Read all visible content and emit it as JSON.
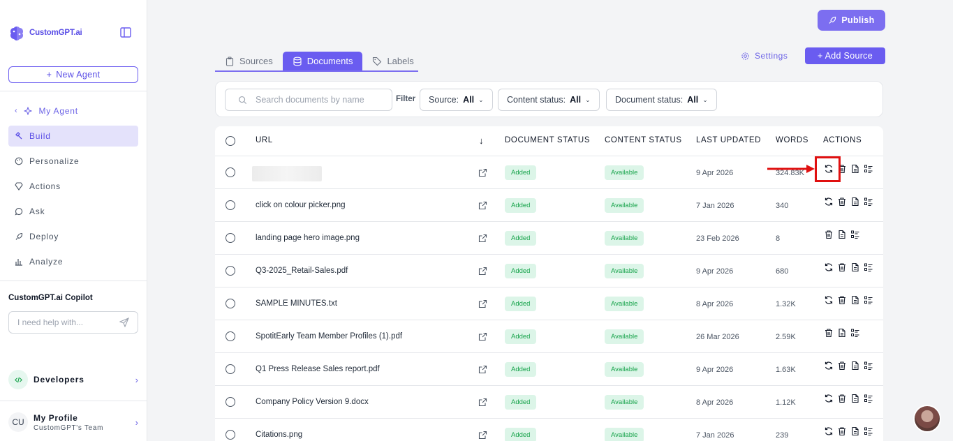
{
  "brand": {
    "name": "CustomGPT.ai"
  },
  "sidebar": {
    "new_agent_label": "New Agent",
    "back_label": "My Agent",
    "items": [
      {
        "label": "Build",
        "icon": "hammer-icon",
        "active": true
      },
      {
        "label": "Personalize",
        "icon": "palette-icon",
        "active": false
      },
      {
        "label": "Actions",
        "icon": "gem-icon",
        "active": false
      },
      {
        "label": "Ask",
        "icon": "chat-icon",
        "active": false
      },
      {
        "label": "Deploy",
        "icon": "rocket-icon",
        "active": false
      },
      {
        "label": "Analyze",
        "icon": "bar-chart-icon",
        "active": false
      }
    ],
    "copilot_title": "CustomGPT.ai Copilot",
    "copilot_placeholder": "I need help with...",
    "developers_label": "Developers",
    "profile": {
      "initials": "CU",
      "name": "My Profile",
      "team": "CustomGPT's Team"
    }
  },
  "header": {
    "publish_label": "Publish",
    "settings_label": "Settings",
    "add_source_label": "Add Source",
    "tabs": [
      {
        "label": "Sources",
        "active": false
      },
      {
        "label": "Documents",
        "active": true
      },
      {
        "label": "Labels",
        "active": false
      }
    ]
  },
  "filters": {
    "search_placeholder": "Search documents by name",
    "filter_label": "Filter",
    "source": {
      "prefix": "Source:",
      "value": "All"
    },
    "content_status": {
      "prefix": "Content status:",
      "value": "All"
    },
    "document_status": {
      "prefix": "Document status:",
      "value": "All"
    }
  },
  "table": {
    "columns": {
      "url": "URL",
      "document_status": "DOCUMENT STATUS",
      "content_status": "CONTENT STATUS",
      "last_updated": "LAST UPDATED",
      "words": "WORDS",
      "actions": "ACTIONS"
    },
    "rows": [
      {
        "name": "",
        "doc_status": "Added",
        "content_status": "Available",
        "date": "9 Apr 2026",
        "words": "324.83K",
        "refresh": true
      },
      {
        "name": "click on colour picker.png",
        "doc_status": "Added",
        "content_status": "Available",
        "date": "7 Jan 2026",
        "words": "340",
        "refresh": true
      },
      {
        "name": "landing page hero image.png",
        "doc_status": "Added",
        "content_status": "Available",
        "date": "23 Feb 2026",
        "words": "8",
        "refresh": false
      },
      {
        "name": "Q3-2025_Retail-Sales.pdf",
        "doc_status": "Added",
        "content_status": "Available",
        "date": "9 Apr 2026",
        "words": "680",
        "refresh": true
      },
      {
        "name": "SAMPLE MINUTES.txt",
        "doc_status": "Added",
        "content_status": "Available",
        "date": "8 Apr 2026",
        "words": "1.32K",
        "refresh": true
      },
      {
        "name": "SpotitEarly Team Member Profiles (1).pdf",
        "doc_status": "Added",
        "content_status": "Available",
        "date": "26 Mar 2026",
        "words": "2.59K",
        "refresh": false
      },
      {
        "name": "Q1 Press Release Sales report.pdf",
        "doc_status": "Added",
        "content_status": "Available",
        "date": "9 Apr 2026",
        "words": "1.63K",
        "refresh": true
      },
      {
        "name": "Company Policy Version 9.docx",
        "doc_status": "Added",
        "content_status": "Available",
        "date": "8 Apr 2026",
        "words": "1.12K",
        "refresh": true
      },
      {
        "name": "Citations.png",
        "doc_status": "Added",
        "content_status": "Available",
        "date": "7 Jan 2026",
        "words": "239",
        "refresh": true
      }
    ]
  },
  "colors": {
    "accent": "#6a5cf0",
    "badge_bg": "#dcf5e8",
    "badge_text": "#16a34a",
    "highlight": "#e01010"
  }
}
